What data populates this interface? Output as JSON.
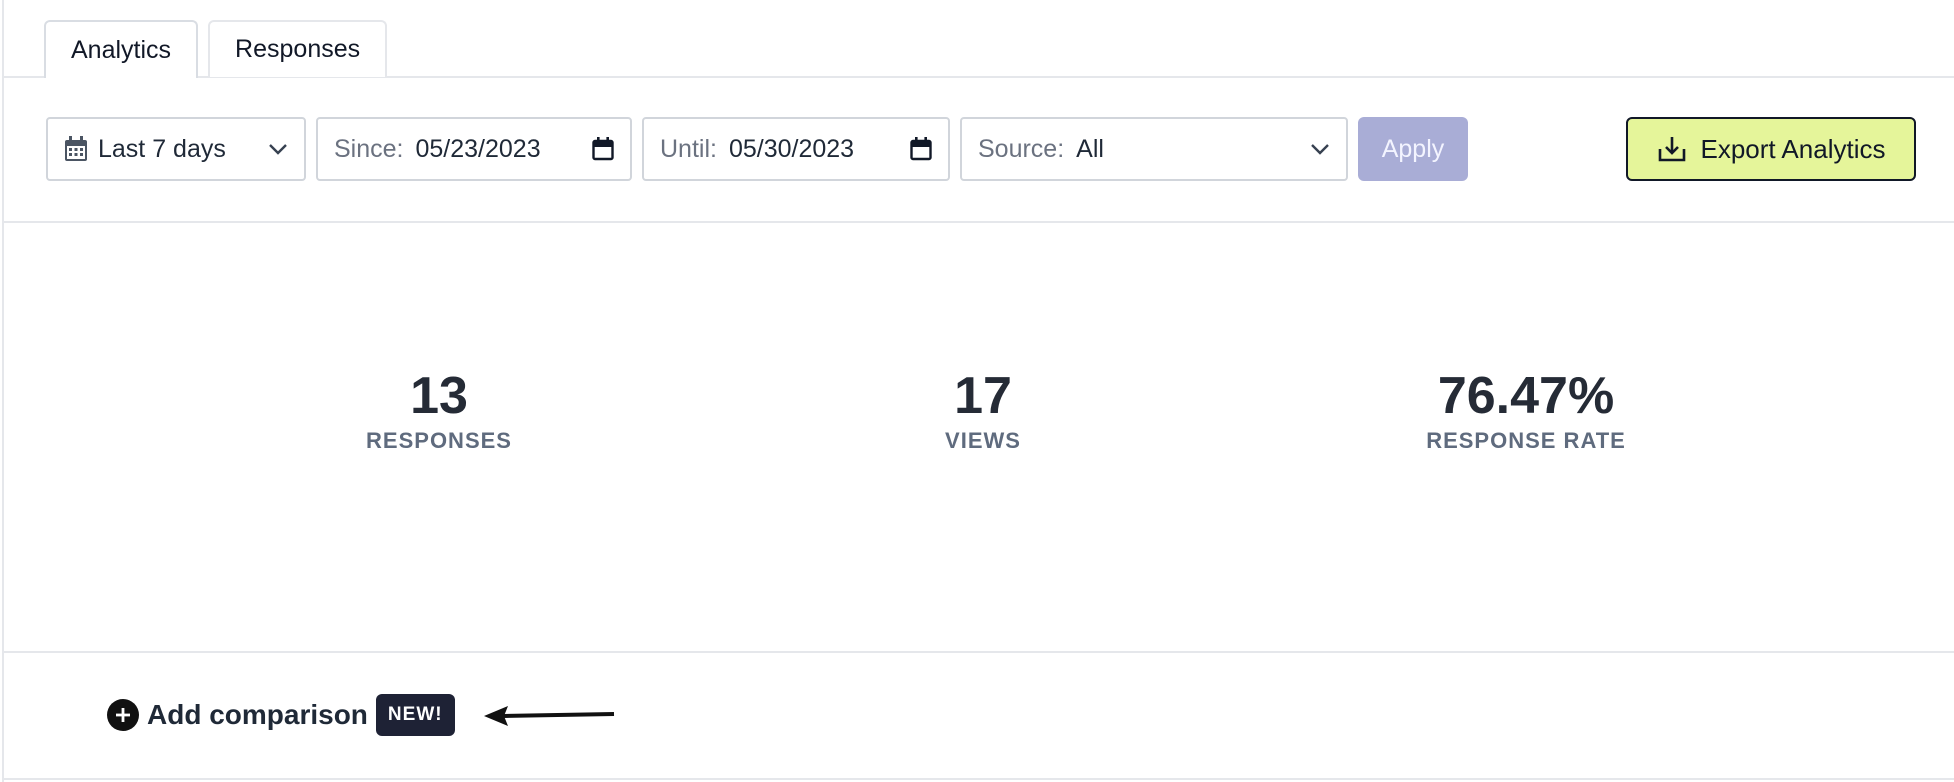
{
  "tabs": [
    {
      "label": "Analytics",
      "active": true
    },
    {
      "label": "Responses",
      "active": false
    }
  ],
  "filters": {
    "preset": "Last 7 days",
    "since_label": "Since:",
    "since_value": "05/23/2023",
    "until_label": "Until:",
    "until_value": "05/30/2023",
    "source_label": "Source:",
    "source_value": "All",
    "apply_label": "Apply"
  },
  "export_label": "Export Analytics",
  "stats": [
    {
      "value": "13",
      "label": "RESPONSES"
    },
    {
      "value": "17",
      "label": "VIEWS"
    },
    {
      "value": "76.47%",
      "label": "RESPONSE RATE"
    }
  ],
  "comparison": {
    "label": "Add comparison",
    "badge": "NEW!"
  },
  "colors": {
    "apply_bg": "#a9add6",
    "export_bg": "#e5f59a",
    "badge_bg": "#1e2235",
    "stat_label": "#5f6b7e"
  },
  "icons": [
    "calendar-icon",
    "chevron-down-icon",
    "date-picker-icon",
    "download-icon",
    "plus-circle-icon",
    "arrow-left-icon"
  ]
}
